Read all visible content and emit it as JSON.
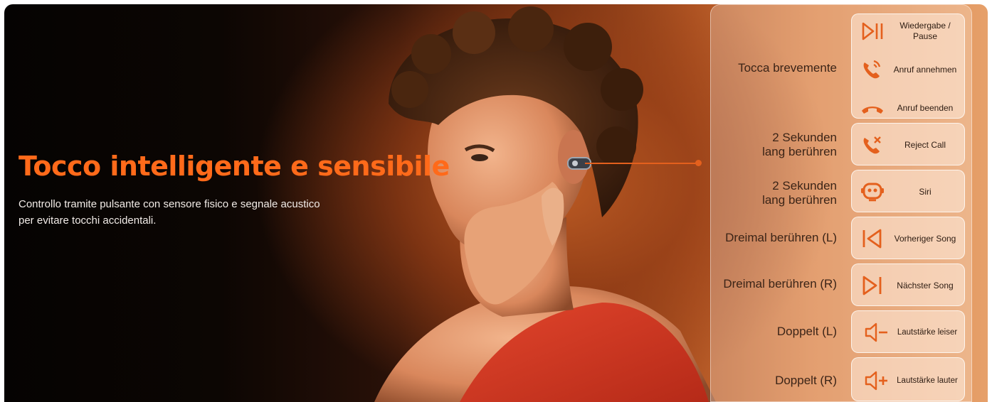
{
  "headline": "Tocco intelligente e sensibile",
  "subtext": {
    "line1": "Controllo tramite pulsante con sensore fisico e segnale acustico",
    "line2": "per evitare tocchi accidentali."
  },
  "colors": {
    "accent": "#ff6a1a",
    "icon": "#e4601d",
    "panel_text": "#3b2417"
  },
  "controls": [
    {
      "gesture_lines": [
        "Tocca brevemente"
      ],
      "actions": [
        {
          "icon": "play-pause-icon",
          "label_lines": [
            "Wiedergabe /",
            "Pause"
          ]
        },
        {
          "icon": "phone-ringing-icon",
          "label_lines": [
            "Anruf annehmen"
          ]
        },
        {
          "icon": "hang-up-icon",
          "label_lines": [
            "Anruf beenden"
          ]
        }
      ]
    },
    {
      "gesture_lines": [
        "2 Sekunden",
        "lang berühren"
      ],
      "actions": [
        {
          "icon": "reject-call-icon",
          "label_lines": [
            "Reject Call"
          ]
        }
      ]
    },
    {
      "gesture_lines": [
        "2 Sekunden",
        "lang berühren"
      ],
      "actions": [
        {
          "icon": "siri-robot-icon",
          "label_lines": [
            "Siri"
          ]
        }
      ]
    },
    {
      "gesture_lines": [
        "Dreimal berühren (L)"
      ],
      "actions": [
        {
          "icon": "previous-track-icon",
          "label_lines": [
            "Vorheriger Song"
          ]
        }
      ]
    },
    {
      "gesture_lines": [
        "Dreimal berühren (R)"
      ],
      "actions": [
        {
          "icon": "next-track-icon",
          "label_lines": [
            "Nächster Song"
          ]
        }
      ]
    },
    {
      "gesture_lines": [
        "Doppelt (L)"
      ],
      "actions": [
        {
          "icon": "volume-down-icon",
          "label_lines": [
            "Lautstärke leiser"
          ]
        }
      ]
    },
    {
      "gesture_lines": [
        "Doppelt (R)"
      ],
      "actions": [
        {
          "icon": "volume-up-icon",
          "label_lines": [
            "Lautstärke lauter"
          ]
        }
      ]
    }
  ]
}
